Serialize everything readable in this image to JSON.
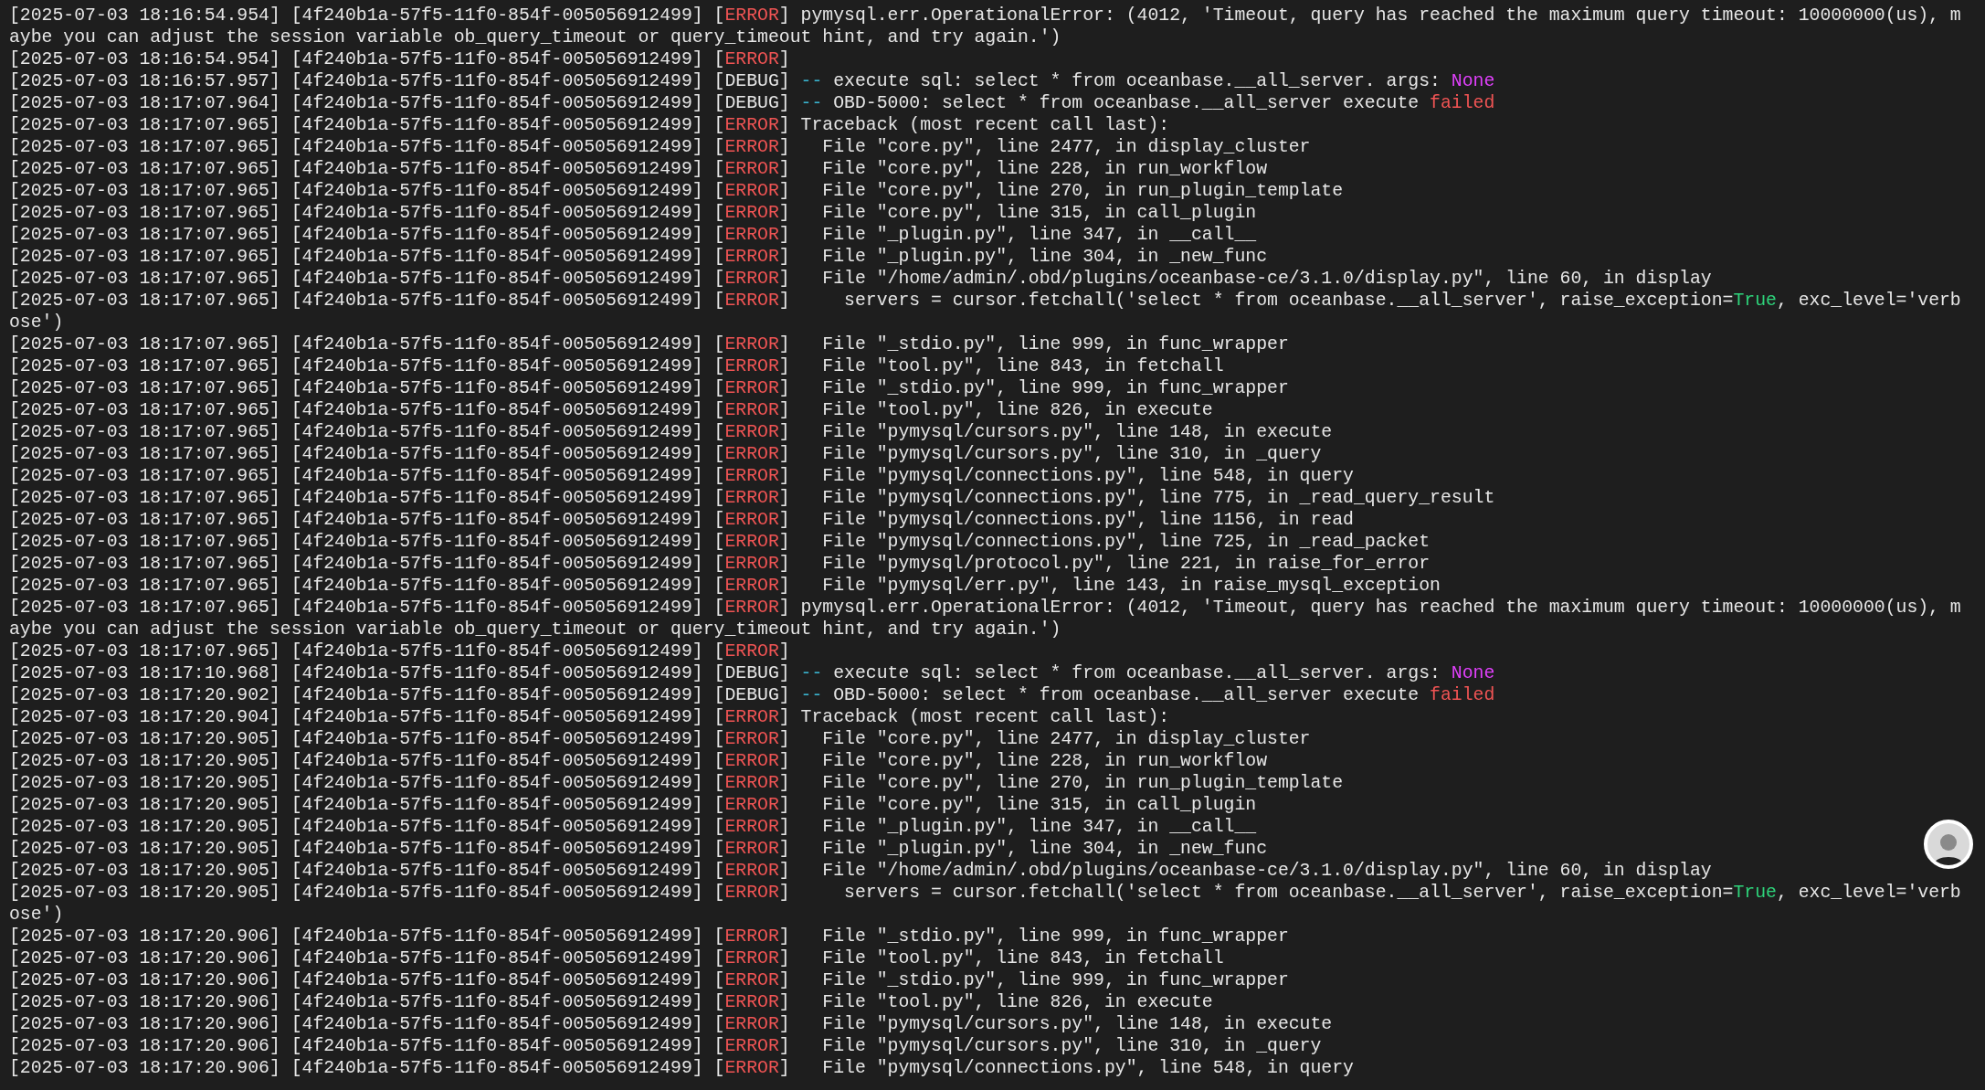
{
  "terminal": {
    "lines": [
      {
        "segments": [
          {
            "text": "[2025-07-03 18:16:54.954] [4f240b1a-57f5-11f0-854f-005056912499] [",
            "kind": "plain"
          },
          {
            "text": "ERROR",
            "kind": "error"
          },
          {
            "text": "] pymysql.err.OperationalError: (4012, 'Timeout, query has reached the maximum query timeout: 10000000(us), m",
            "kind": "plain"
          }
        ]
      },
      {
        "segments": [
          {
            "text": "aybe you can adjust the session variable ob_query_timeout or query_timeout hint, and try again.')",
            "kind": "plain"
          }
        ]
      },
      {
        "segments": [
          {
            "text": "[2025-07-03 18:16:54.954] [4f240b1a-57f5-11f0-854f-005056912499] [",
            "kind": "plain"
          },
          {
            "text": "ERROR",
            "kind": "error"
          },
          {
            "text": "]",
            "kind": "plain"
          }
        ]
      },
      {
        "segments": [
          {
            "text": "[2025-07-03 18:16:57.957] [4f240b1a-57f5-11f0-854f-005056912499] [DEBUG] ",
            "kind": "plain"
          },
          {
            "text": "--",
            "kind": "dash"
          },
          {
            "text": " execute sql: select * from oceanbase.__all_server. args: ",
            "kind": "plain"
          },
          {
            "text": "None",
            "kind": "none"
          }
        ]
      },
      {
        "segments": [
          {
            "text": "[2025-07-03 18:17:07.964] [4f240b1a-57f5-11f0-854f-005056912499] [DEBUG] ",
            "kind": "plain"
          },
          {
            "text": "--",
            "kind": "dash"
          },
          {
            "text": " OBD-5000: select * from oceanbase.__all_server execute ",
            "kind": "plain"
          },
          {
            "text": "failed",
            "kind": "error"
          }
        ]
      },
      {
        "segments": [
          {
            "text": "[2025-07-03 18:17:07.965] [4f240b1a-57f5-11f0-854f-005056912499] [",
            "kind": "plain"
          },
          {
            "text": "ERROR",
            "kind": "error"
          },
          {
            "text": "] Traceback (most recent call last):",
            "kind": "plain"
          }
        ]
      },
      {
        "segments": [
          {
            "text": "[2025-07-03 18:17:07.965] [4f240b1a-57f5-11f0-854f-005056912499] [",
            "kind": "plain"
          },
          {
            "text": "ERROR",
            "kind": "error"
          },
          {
            "text": "]   File \"core.py\", line 2477, in display_cluster",
            "kind": "plain"
          }
        ]
      },
      {
        "segments": [
          {
            "text": "[2025-07-03 18:17:07.965] [4f240b1a-57f5-11f0-854f-005056912499] [",
            "kind": "plain"
          },
          {
            "text": "ERROR",
            "kind": "error"
          },
          {
            "text": "]   File \"core.py\", line 228, in run_workflow",
            "kind": "plain"
          }
        ]
      },
      {
        "segments": [
          {
            "text": "[2025-07-03 18:17:07.965] [4f240b1a-57f5-11f0-854f-005056912499] [",
            "kind": "plain"
          },
          {
            "text": "ERROR",
            "kind": "error"
          },
          {
            "text": "]   File \"core.py\", line 270, in run_plugin_template",
            "kind": "plain"
          }
        ]
      },
      {
        "segments": [
          {
            "text": "[2025-07-03 18:17:07.965] [4f240b1a-57f5-11f0-854f-005056912499] [",
            "kind": "plain"
          },
          {
            "text": "ERROR",
            "kind": "error"
          },
          {
            "text": "]   File \"core.py\", line 315, in call_plugin",
            "kind": "plain"
          }
        ]
      },
      {
        "segments": [
          {
            "text": "[2025-07-03 18:17:07.965] [4f240b1a-57f5-11f0-854f-005056912499] [",
            "kind": "plain"
          },
          {
            "text": "ERROR",
            "kind": "error"
          },
          {
            "text": "]   File \"_plugin.py\", line 347, in __call__",
            "kind": "plain"
          }
        ]
      },
      {
        "segments": [
          {
            "text": "[2025-07-03 18:17:07.965] [4f240b1a-57f5-11f0-854f-005056912499] [",
            "kind": "plain"
          },
          {
            "text": "ERROR",
            "kind": "error"
          },
          {
            "text": "]   File \"_plugin.py\", line 304, in _new_func",
            "kind": "plain"
          }
        ]
      },
      {
        "segments": [
          {
            "text": "[2025-07-03 18:17:07.965] [4f240b1a-57f5-11f0-854f-005056912499] [",
            "kind": "plain"
          },
          {
            "text": "ERROR",
            "kind": "error"
          },
          {
            "text": "]   File \"/home/admin/.obd/plugins/oceanbase-ce/3.1.0/display.py\", line 60, in display",
            "kind": "plain"
          }
        ]
      },
      {
        "segments": [
          {
            "text": "[2025-07-03 18:17:07.965] [4f240b1a-57f5-11f0-854f-005056912499] [",
            "kind": "plain"
          },
          {
            "text": "ERROR",
            "kind": "error"
          },
          {
            "text": "]     servers = cursor.fetchall('select * from oceanbase.__all_server', raise_exception=",
            "kind": "plain"
          },
          {
            "text": "True",
            "kind": "true"
          },
          {
            "text": ", exc_level='verb",
            "kind": "plain"
          }
        ]
      },
      {
        "segments": [
          {
            "text": "ose')",
            "kind": "plain"
          }
        ]
      },
      {
        "segments": [
          {
            "text": "[2025-07-03 18:17:07.965] [4f240b1a-57f5-11f0-854f-005056912499] [",
            "kind": "plain"
          },
          {
            "text": "ERROR",
            "kind": "error"
          },
          {
            "text": "]   File \"_stdio.py\", line 999, in func_wrapper",
            "kind": "plain"
          }
        ]
      },
      {
        "segments": [
          {
            "text": "[2025-07-03 18:17:07.965] [4f240b1a-57f5-11f0-854f-005056912499] [",
            "kind": "plain"
          },
          {
            "text": "ERROR",
            "kind": "error"
          },
          {
            "text": "]   File \"tool.py\", line 843, in fetchall",
            "kind": "plain"
          }
        ]
      },
      {
        "segments": [
          {
            "text": "[2025-07-03 18:17:07.965] [4f240b1a-57f5-11f0-854f-005056912499] [",
            "kind": "plain"
          },
          {
            "text": "ERROR",
            "kind": "error"
          },
          {
            "text": "]   File \"_stdio.py\", line 999, in func_wrapper",
            "kind": "plain"
          }
        ]
      },
      {
        "segments": [
          {
            "text": "[2025-07-03 18:17:07.965] [4f240b1a-57f5-11f0-854f-005056912499] [",
            "kind": "plain"
          },
          {
            "text": "ERROR",
            "kind": "error"
          },
          {
            "text": "]   File \"tool.py\", line 826, in execute",
            "kind": "plain"
          }
        ]
      },
      {
        "segments": [
          {
            "text": "[2025-07-03 18:17:07.965] [4f240b1a-57f5-11f0-854f-005056912499] [",
            "kind": "plain"
          },
          {
            "text": "ERROR",
            "kind": "error"
          },
          {
            "text": "]   File \"pymysql/cursors.py\", line 148, in execute",
            "kind": "plain"
          }
        ]
      },
      {
        "segments": [
          {
            "text": "[2025-07-03 18:17:07.965] [4f240b1a-57f5-11f0-854f-005056912499] [",
            "kind": "plain"
          },
          {
            "text": "ERROR",
            "kind": "error"
          },
          {
            "text": "]   File \"pymysql/cursors.py\", line 310, in _query",
            "kind": "plain"
          }
        ]
      },
      {
        "segments": [
          {
            "text": "[2025-07-03 18:17:07.965] [4f240b1a-57f5-11f0-854f-005056912499] [",
            "kind": "plain"
          },
          {
            "text": "ERROR",
            "kind": "error"
          },
          {
            "text": "]   File \"pymysql/connections.py\", line 548, in query",
            "kind": "plain"
          }
        ]
      },
      {
        "segments": [
          {
            "text": "[2025-07-03 18:17:07.965] [4f240b1a-57f5-11f0-854f-005056912499] [",
            "kind": "plain"
          },
          {
            "text": "ERROR",
            "kind": "error"
          },
          {
            "text": "]   File \"pymysql/connections.py\", line 775, in _read_query_result",
            "kind": "plain"
          }
        ]
      },
      {
        "segments": [
          {
            "text": "[2025-07-03 18:17:07.965] [4f240b1a-57f5-11f0-854f-005056912499] [",
            "kind": "plain"
          },
          {
            "text": "ERROR",
            "kind": "error"
          },
          {
            "text": "]   File \"pymysql/connections.py\", line 1156, in read",
            "kind": "plain"
          }
        ]
      },
      {
        "segments": [
          {
            "text": "[2025-07-03 18:17:07.965] [4f240b1a-57f5-11f0-854f-005056912499] [",
            "kind": "plain"
          },
          {
            "text": "ERROR",
            "kind": "error"
          },
          {
            "text": "]   File \"pymysql/connections.py\", line 725, in _read_packet",
            "kind": "plain"
          }
        ]
      },
      {
        "segments": [
          {
            "text": "[2025-07-03 18:17:07.965] [4f240b1a-57f5-11f0-854f-005056912499] [",
            "kind": "plain"
          },
          {
            "text": "ERROR",
            "kind": "error"
          },
          {
            "text": "]   File \"pymysql/protocol.py\", line 221, in raise_for_error",
            "kind": "plain"
          }
        ]
      },
      {
        "segments": [
          {
            "text": "[2025-07-03 18:17:07.965] [4f240b1a-57f5-11f0-854f-005056912499] [",
            "kind": "plain"
          },
          {
            "text": "ERROR",
            "kind": "error"
          },
          {
            "text": "]   File \"pymysql/err.py\", line 143, in raise_mysql_exception",
            "kind": "plain"
          }
        ]
      },
      {
        "segments": [
          {
            "text": "[2025-07-03 18:17:07.965] [4f240b1a-57f5-11f0-854f-005056912499] [",
            "kind": "plain"
          },
          {
            "text": "ERROR",
            "kind": "error"
          },
          {
            "text": "] pymysql.err.OperationalError: (4012, 'Timeout, query has reached the maximum query timeout: 10000000(us), m",
            "kind": "plain"
          }
        ]
      },
      {
        "segments": [
          {
            "text": "aybe you can adjust the session variable ob_query_timeout or query_timeout hint, and try again.')",
            "kind": "plain"
          }
        ]
      },
      {
        "segments": [
          {
            "text": "[2025-07-03 18:17:07.965] [4f240b1a-57f5-11f0-854f-005056912499] [",
            "kind": "plain"
          },
          {
            "text": "ERROR",
            "kind": "error"
          },
          {
            "text": "]",
            "kind": "plain"
          }
        ]
      },
      {
        "segments": [
          {
            "text": "[2025-07-03 18:17:10.968] [4f240b1a-57f5-11f0-854f-005056912499] [DEBUG] ",
            "kind": "plain"
          },
          {
            "text": "--",
            "kind": "dash"
          },
          {
            "text": " execute sql: select * from oceanbase.__all_server. args: ",
            "kind": "plain"
          },
          {
            "text": "None",
            "kind": "none"
          }
        ]
      },
      {
        "segments": [
          {
            "text": "[2025-07-03 18:17:20.902] [4f240b1a-57f5-11f0-854f-005056912499] [DEBUG] ",
            "kind": "plain"
          },
          {
            "text": "--",
            "kind": "dash"
          },
          {
            "text": " OBD-5000: select * from oceanbase.__all_server execute ",
            "kind": "plain"
          },
          {
            "text": "failed",
            "kind": "error"
          }
        ]
      },
      {
        "segments": [
          {
            "text": "[2025-07-03 18:17:20.904] [4f240b1a-57f5-11f0-854f-005056912499] [",
            "kind": "plain"
          },
          {
            "text": "ERROR",
            "kind": "error"
          },
          {
            "text": "] Traceback (most recent call last):",
            "kind": "plain"
          }
        ]
      },
      {
        "segments": [
          {
            "text": "[2025-07-03 18:17:20.905] [4f240b1a-57f5-11f0-854f-005056912499] [",
            "kind": "plain"
          },
          {
            "text": "ERROR",
            "kind": "error"
          },
          {
            "text": "]   File \"core.py\", line 2477, in display_cluster",
            "kind": "plain"
          }
        ]
      },
      {
        "segments": [
          {
            "text": "[2025-07-03 18:17:20.905] [4f240b1a-57f5-11f0-854f-005056912499] [",
            "kind": "plain"
          },
          {
            "text": "ERROR",
            "kind": "error"
          },
          {
            "text": "]   File \"core.py\", line 228, in run_workflow",
            "kind": "plain"
          }
        ]
      },
      {
        "segments": [
          {
            "text": "[2025-07-03 18:17:20.905] [4f240b1a-57f5-11f0-854f-005056912499] [",
            "kind": "plain"
          },
          {
            "text": "ERROR",
            "kind": "error"
          },
          {
            "text": "]   File \"core.py\", line 270, in run_plugin_template",
            "kind": "plain"
          }
        ]
      },
      {
        "segments": [
          {
            "text": "[2025-07-03 18:17:20.905] [4f240b1a-57f5-11f0-854f-005056912499] [",
            "kind": "plain"
          },
          {
            "text": "ERROR",
            "kind": "error"
          },
          {
            "text": "]   File \"core.py\", line 315, in call_plugin",
            "kind": "plain"
          }
        ]
      },
      {
        "segments": [
          {
            "text": "[2025-07-03 18:17:20.905] [4f240b1a-57f5-11f0-854f-005056912499] [",
            "kind": "plain"
          },
          {
            "text": "ERROR",
            "kind": "error"
          },
          {
            "text": "]   File \"_plugin.py\", line 347, in __call__",
            "kind": "plain"
          }
        ]
      },
      {
        "segments": [
          {
            "text": "[2025-07-03 18:17:20.905] [4f240b1a-57f5-11f0-854f-005056912499] [",
            "kind": "plain"
          },
          {
            "text": "ERROR",
            "kind": "error"
          },
          {
            "text": "]   File \"_plugin.py\", line 304, in _new_func",
            "kind": "plain"
          }
        ]
      },
      {
        "segments": [
          {
            "text": "[2025-07-03 18:17:20.905] [4f240b1a-57f5-11f0-854f-005056912499] [",
            "kind": "plain"
          },
          {
            "text": "ERROR",
            "kind": "error"
          },
          {
            "text": "]   File \"/home/admin/.obd/plugins/oceanbase-ce/3.1.0/display.py\", line 60, in display",
            "kind": "plain"
          }
        ]
      },
      {
        "segments": [
          {
            "text": "[2025-07-03 18:17:20.905] [4f240b1a-57f5-11f0-854f-005056912499] [",
            "kind": "plain"
          },
          {
            "text": "ERROR",
            "kind": "error"
          },
          {
            "text": "]     servers = cursor.fetchall('select * from oceanbase.__all_server', raise_exception=",
            "kind": "plain"
          },
          {
            "text": "True",
            "kind": "true"
          },
          {
            "text": ", exc_level='verb",
            "kind": "plain"
          }
        ]
      },
      {
        "segments": [
          {
            "text": "ose')",
            "kind": "plain"
          }
        ]
      },
      {
        "segments": [
          {
            "text": "[2025-07-03 18:17:20.906] [4f240b1a-57f5-11f0-854f-005056912499] [",
            "kind": "plain"
          },
          {
            "text": "ERROR",
            "kind": "error"
          },
          {
            "text": "]   File \"_stdio.py\", line 999, in func_wrapper",
            "kind": "plain"
          }
        ]
      },
      {
        "segments": [
          {
            "text": "[2025-07-03 18:17:20.906] [4f240b1a-57f5-11f0-854f-005056912499] [",
            "kind": "plain"
          },
          {
            "text": "ERROR",
            "kind": "error"
          },
          {
            "text": "]   File \"tool.py\", line 843, in fetchall",
            "kind": "plain"
          }
        ]
      },
      {
        "segments": [
          {
            "text": "[2025-07-03 18:17:20.906] [4f240b1a-57f5-11f0-854f-005056912499] [",
            "kind": "plain"
          },
          {
            "text": "ERROR",
            "kind": "error"
          },
          {
            "text": "]   File \"_stdio.py\", line 999, in func_wrapper",
            "kind": "plain"
          }
        ]
      },
      {
        "segments": [
          {
            "text": "[2025-07-03 18:17:20.906] [4f240b1a-57f5-11f0-854f-005056912499] [",
            "kind": "plain"
          },
          {
            "text": "ERROR",
            "kind": "error"
          },
          {
            "text": "]   File \"tool.py\", line 826, in execute",
            "kind": "plain"
          }
        ]
      },
      {
        "segments": [
          {
            "text": "[2025-07-03 18:17:20.906] [4f240b1a-57f5-11f0-854f-005056912499] [",
            "kind": "plain"
          },
          {
            "text": "ERROR",
            "kind": "error"
          },
          {
            "text": "]   File \"pymysql/cursors.py\", line 148, in execute",
            "kind": "plain"
          }
        ]
      },
      {
        "segments": [
          {
            "text": "[2025-07-03 18:17:20.906] [4f240b1a-57f5-11f0-854f-005056912499] [",
            "kind": "plain"
          },
          {
            "text": "ERROR",
            "kind": "error"
          },
          {
            "text": "]   File \"pymysql/cursors.py\", line 310, in _query",
            "kind": "plain"
          }
        ]
      },
      {
        "segments": [
          {
            "text": "[2025-07-03 18:17:20.906] [4f240b1a-57f5-11f0-854f-005056912499] [",
            "kind": "plain"
          },
          {
            "text": "ERROR",
            "kind": "error"
          },
          {
            "text": "]   File \"pymysql/connections.py\", line 548, in query",
            "kind": "plain"
          }
        ]
      }
    ]
  }
}
